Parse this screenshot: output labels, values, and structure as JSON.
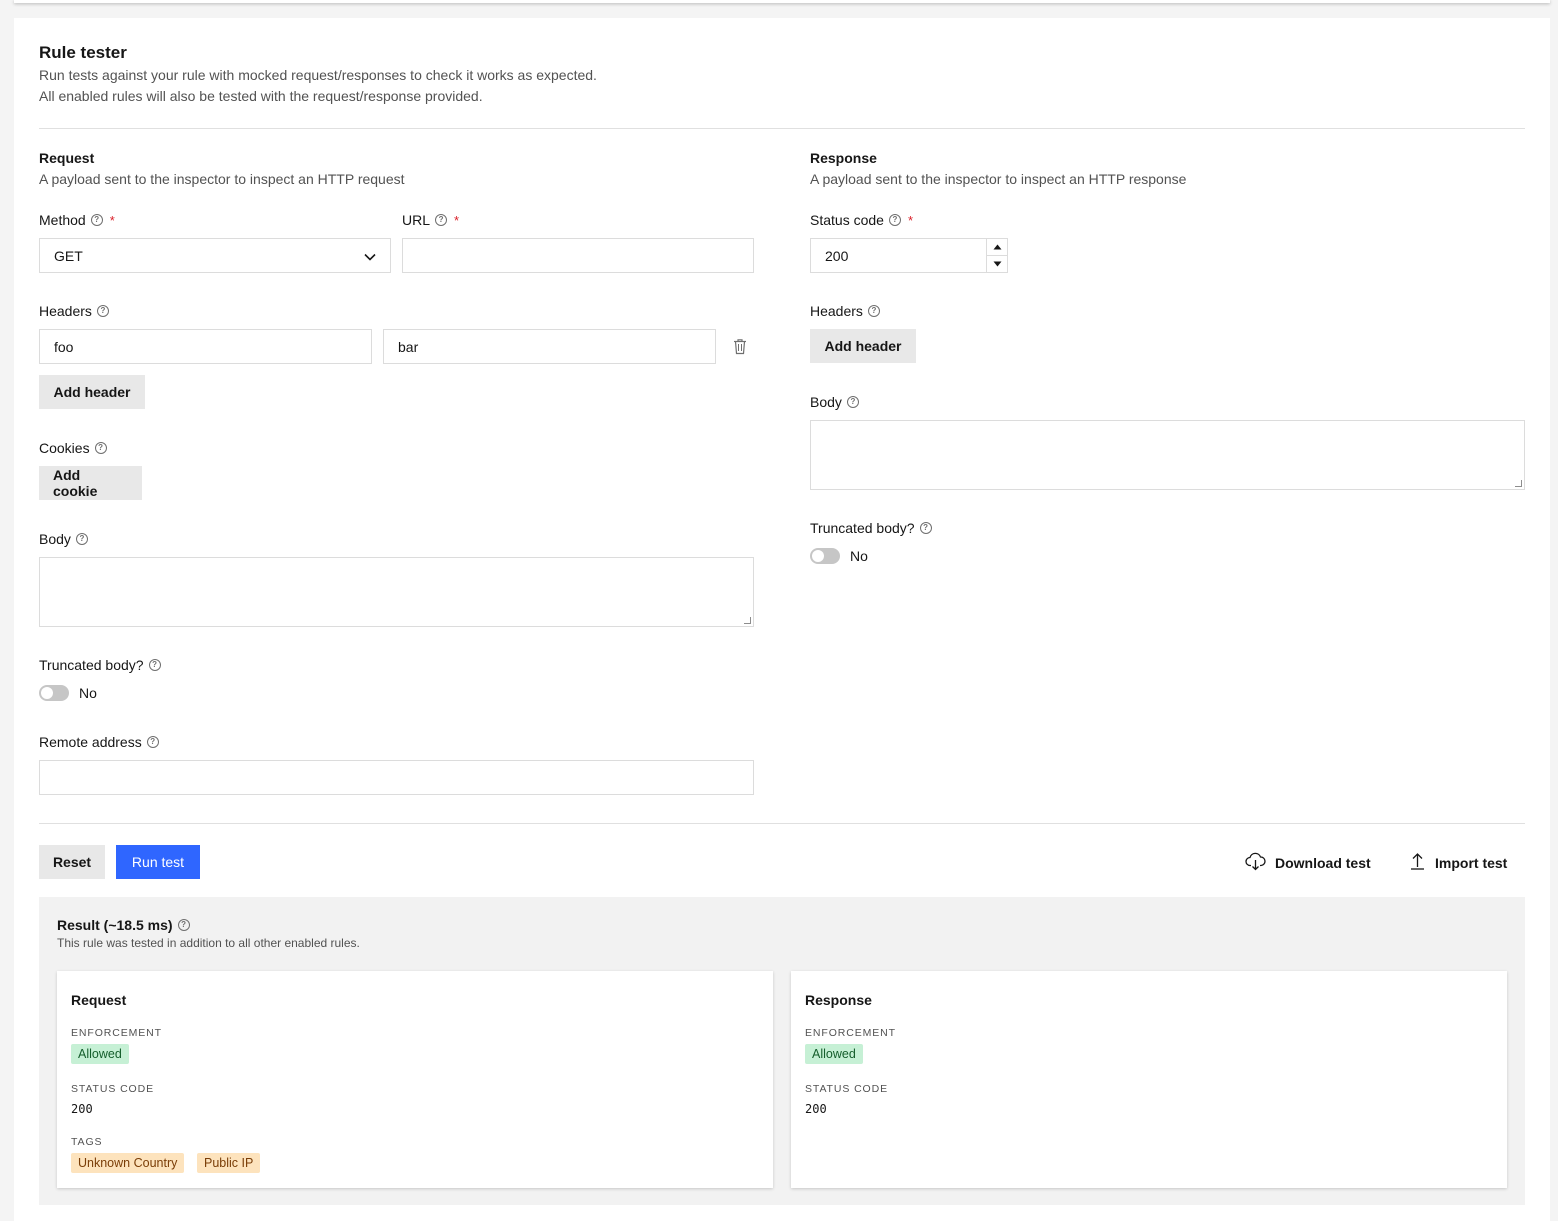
{
  "header": {
    "title": "Rule tester",
    "desc_line1": "Run tests against your rule with mocked request/responses to check it works as expected.",
    "desc_line2": "All enabled rules will also be tested with the request/response provided."
  },
  "request": {
    "title": "Request",
    "desc": "A payload sent to the inspector to inspect an HTTP request",
    "method_label": "Method",
    "method_value": "GET",
    "url_label": "URL",
    "url_value": "",
    "headers_label": "Headers",
    "header_key": "foo",
    "header_value": "bar",
    "add_header": "Add header",
    "cookies_label": "Cookies",
    "add_cookie": "Add cookie",
    "body_label": "Body",
    "truncated_label": "Truncated body?",
    "truncated_value": "No",
    "remote_label": "Remote address",
    "remote_value": ""
  },
  "response": {
    "title": "Response",
    "desc": "A payload sent to the inspector to inspect an HTTP response",
    "status_label": "Status code",
    "status_value": "200",
    "headers_label": "Headers",
    "add_header": "Add header",
    "body_label": "Body",
    "truncated_label": "Truncated body?",
    "truncated_value": "No"
  },
  "actions": {
    "reset": "Reset",
    "run": "Run test",
    "download": "Download test",
    "import": "Import test"
  },
  "result": {
    "title": "Result (~18.5 ms)",
    "desc": "This rule was tested in addition to all other enabled rules.",
    "request": {
      "title": "Request",
      "enforcement_label": "ENFORCEMENT",
      "enforcement": "Allowed",
      "status_label": "STATUS CODE",
      "status": "200",
      "tags_label": "TAGS",
      "tags": [
        "Unknown Country",
        "Public IP"
      ]
    },
    "response": {
      "title": "Response",
      "enforcement_label": "ENFORCEMENT",
      "enforcement": "Allowed",
      "status_label": "STATUS CODE",
      "status": "200"
    }
  },
  "colors": {
    "primary": "#2f66ff",
    "success_bg": "#c6f0d5",
    "warning_bg": "#fde3bd",
    "required": "#da1e28"
  }
}
